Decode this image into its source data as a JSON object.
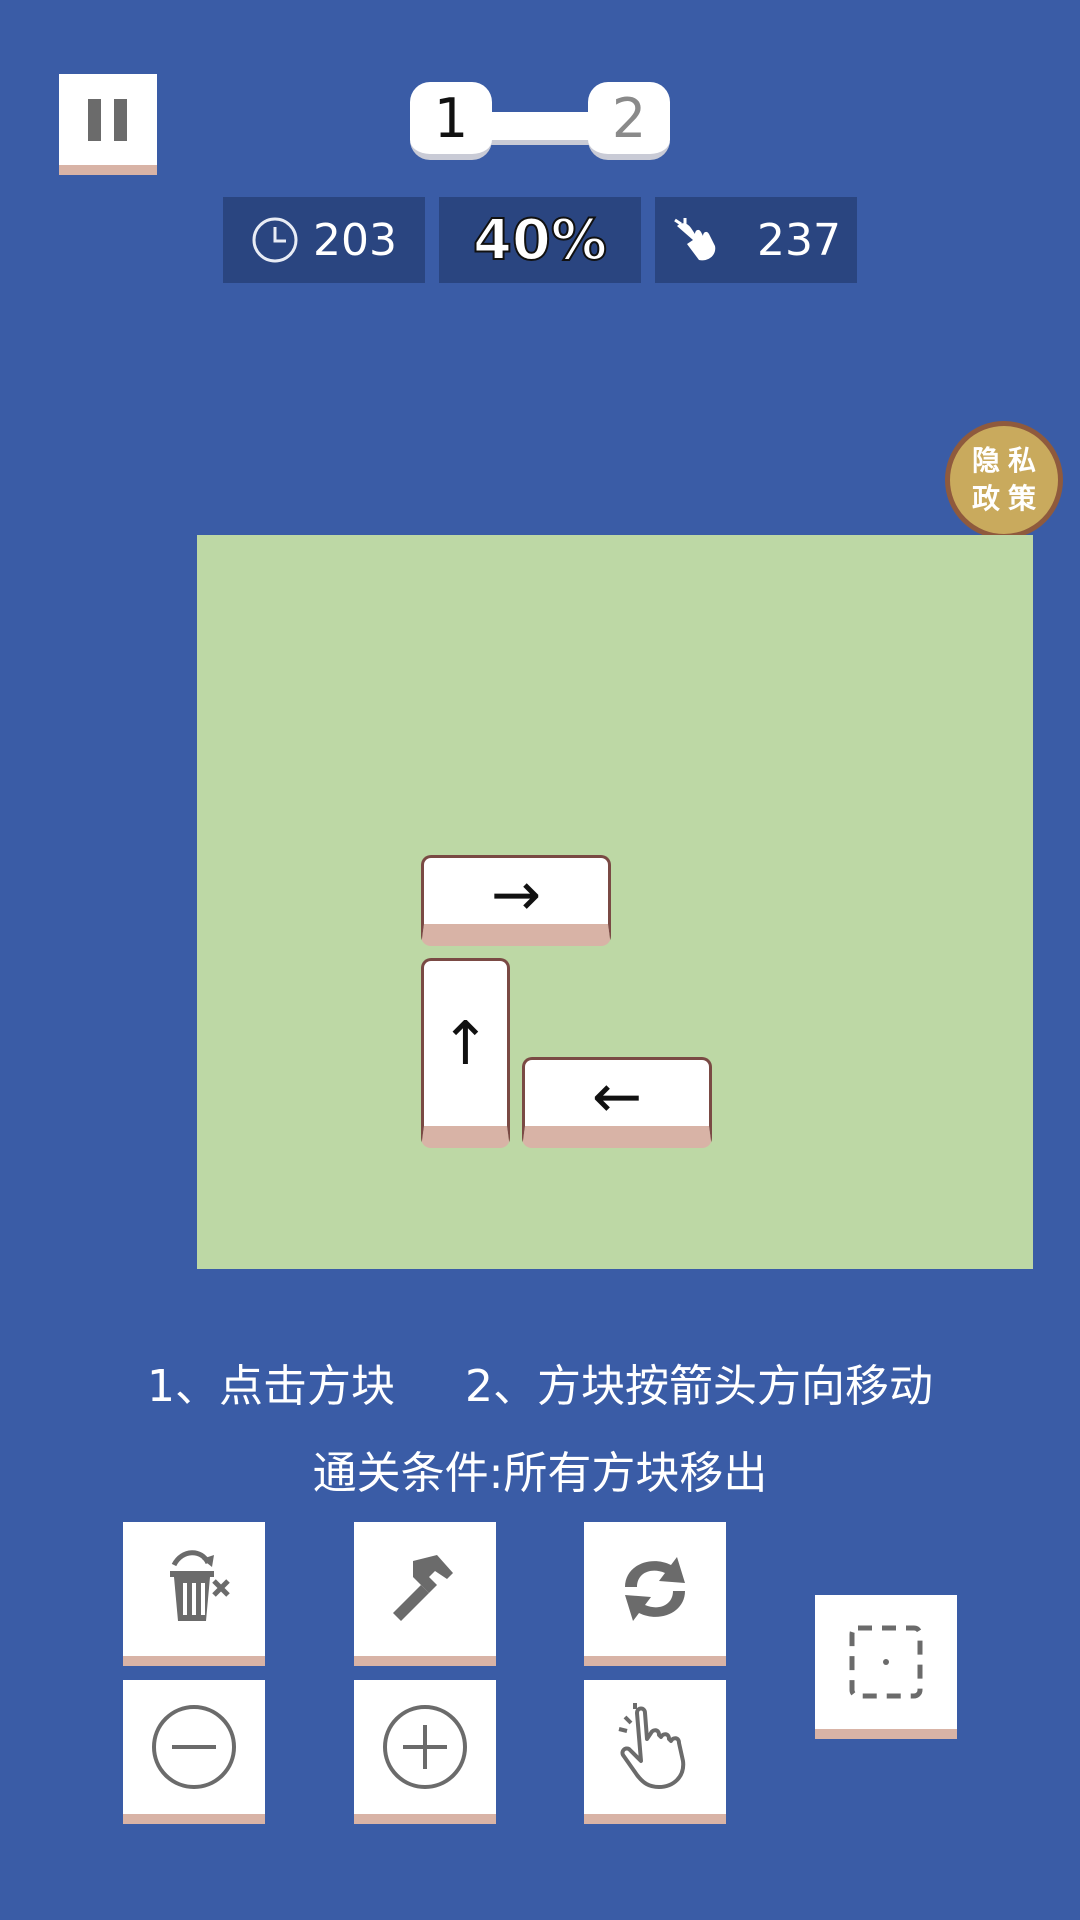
{
  "level": {
    "current": "1",
    "next": "2"
  },
  "stats": {
    "time": "203",
    "progress": "40%",
    "moves": "237"
  },
  "privacy": {
    "line1": "隐私",
    "line2": "政策"
  },
  "blocks": [
    {
      "direction": "right",
      "arrow": "→"
    },
    {
      "direction": "up",
      "arrow": "↑"
    },
    {
      "direction": "left",
      "arrow": "←"
    }
  ],
  "instructions": {
    "step1": "1、点击方块",
    "step2": "2、方块按箭头方向移动",
    "goal": "通关条件:所有方块移出"
  },
  "tools": [
    {
      "icon": "trash-icon"
    },
    {
      "icon": "hammer-icon"
    },
    {
      "icon": "refresh-icon"
    },
    {
      "icon": "minus-icon"
    },
    {
      "icon": "plus-icon"
    },
    {
      "icon": "hand-pointer-icon"
    },
    {
      "icon": "focus-frame-icon"
    }
  ],
  "colors": {
    "background": "#3a5ca6",
    "stat_box": "#2a4580",
    "board": "#bdd8a5",
    "block_shadow": "#d8b3a6",
    "block_border": "#7a4a44",
    "seal": "#c9aa5d"
  }
}
